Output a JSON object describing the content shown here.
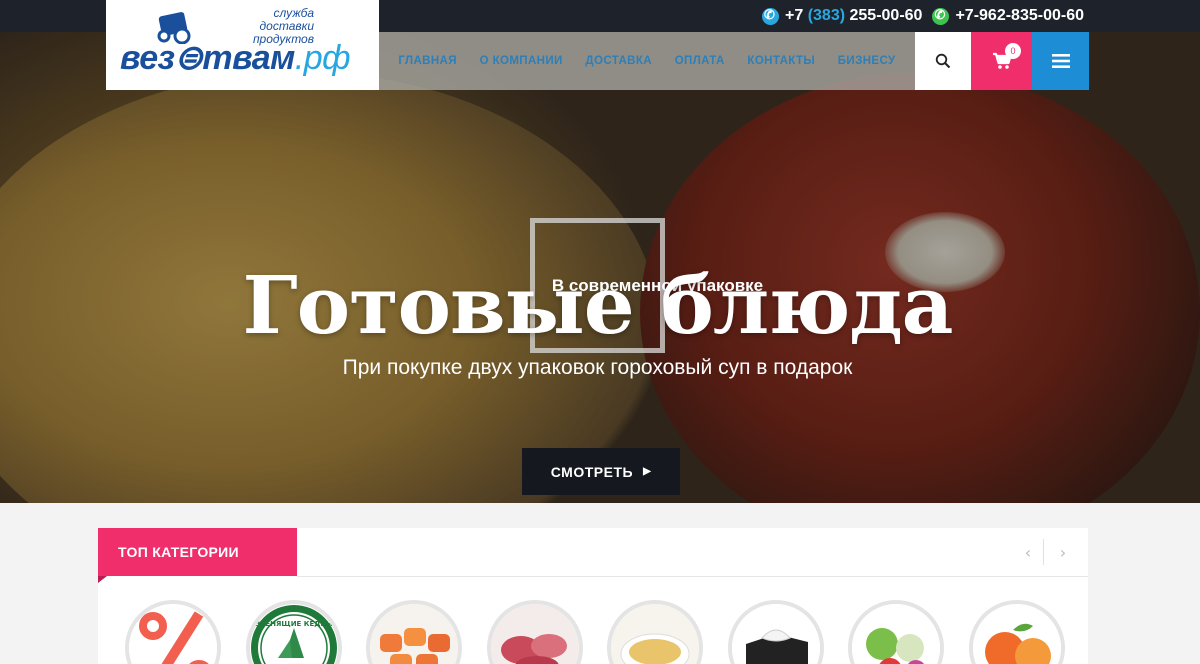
{
  "topbar": {
    "phone1_prefix": "+7",
    "phone1_code": "(383)",
    "phone1_number": "255-00-60",
    "phone2": "+7-962-835-00-60"
  },
  "logo": {
    "tagline_line1": "служба",
    "tagline_line2": "доставки",
    "tagline_line3": "продуктов",
    "wordmark_main": "вез⊜твам",
    "wordmark_suffix": ".рф"
  },
  "nav": {
    "items": [
      "ГЛАВНАЯ",
      "О КОМПАНИИ",
      "ДОСТАВКА",
      "ОПЛАТА",
      "КОНТАКТЫ",
      "БИЗНЕСУ"
    ],
    "cart_count": "0"
  },
  "hero": {
    "kicker": "В современной упаковке",
    "title": "Готовые блюда",
    "subtitle": "При покупке двух упаковок гороховый суп в подарок",
    "button_label": "СМОТРЕТЬ"
  },
  "categories": {
    "heading": "ТОП КАТЕГОРИИ",
    "badge_text": "ЗВЕНЯЩИЕ КЕДРЫ"
  },
  "colors": {
    "accent_pink": "#f02e6c",
    "accent_blue": "#1d8ed6",
    "nav_text": "#2c7fb8",
    "topbar": "#1e222b"
  }
}
